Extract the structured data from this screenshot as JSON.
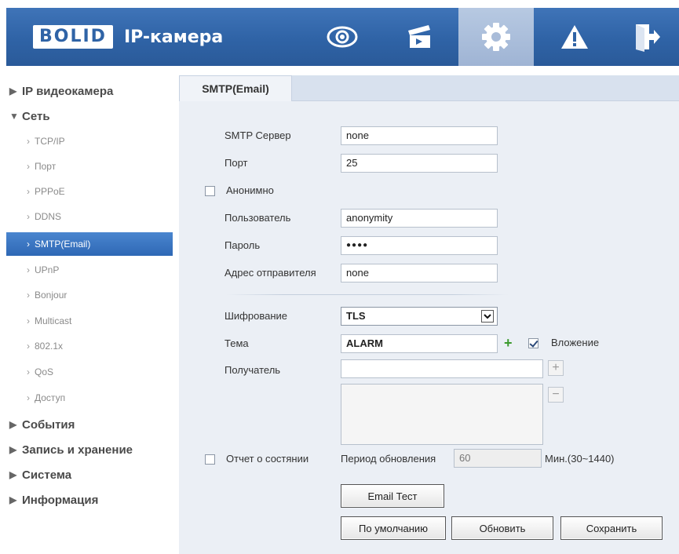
{
  "header": {
    "logo": "BOLID",
    "title": "IP-камера",
    "nav": [
      {
        "icon": "eye-icon",
        "active": false
      },
      {
        "icon": "clapperboard-icon",
        "active": false
      },
      {
        "icon": "gear-icon",
        "active": true
      },
      {
        "icon": "alarm-warning-icon",
        "active": false
      },
      {
        "icon": "logout-icon",
        "active": false
      }
    ],
    "brand_color": "#2f63a6"
  },
  "sidebar": {
    "sections": [
      {
        "label": "IP видеокамера",
        "expanded": false
      },
      {
        "label": "Сеть",
        "expanded": true
      },
      {
        "label": "События",
        "expanded": false
      },
      {
        "label": "Запись и хранение",
        "expanded": false
      },
      {
        "label": "Система",
        "expanded": false
      },
      {
        "label": "Информация",
        "expanded": false
      }
    ],
    "network_items": [
      "TCP/IP",
      "Порт",
      "PPPoE",
      "DDNS",
      "SMTP(Email)",
      "UPnP",
      "Bonjour",
      "Multicast",
      "802.1x",
      "QoS",
      "Доступ"
    ],
    "active_item": "SMTP(Email)"
  },
  "tab": {
    "label": "SMTP(Email)"
  },
  "form": {
    "smtp_server": {
      "label": "SMTP Сервер",
      "value": "none"
    },
    "port": {
      "label": "Порт",
      "value": "25"
    },
    "anonymous": {
      "label": "Анонимно",
      "checked": false
    },
    "user": {
      "label": "Пользователь",
      "value": "anonymity"
    },
    "password": {
      "label": "Пароль",
      "value": "●●●●"
    },
    "sender": {
      "label": "Адрес отправителя",
      "value": "none"
    },
    "encryption": {
      "label": "Шифрование",
      "value": "TLS"
    },
    "subject": {
      "label": "Тема",
      "value": "ALARM"
    },
    "attachment": {
      "label": "Вложение",
      "checked": true
    },
    "recipient": {
      "label": "Получатель",
      "value": ""
    },
    "health_report": {
      "label": "Отчет о состянии",
      "checked": false
    },
    "update_period": {
      "label": "Период обновления",
      "value": "60",
      "unit": "Мин.(30~1440)"
    }
  },
  "buttons": {
    "email_test": "Email Тест",
    "default": "По умолчанию",
    "refresh": "Обновить",
    "save": "Сохранить"
  }
}
